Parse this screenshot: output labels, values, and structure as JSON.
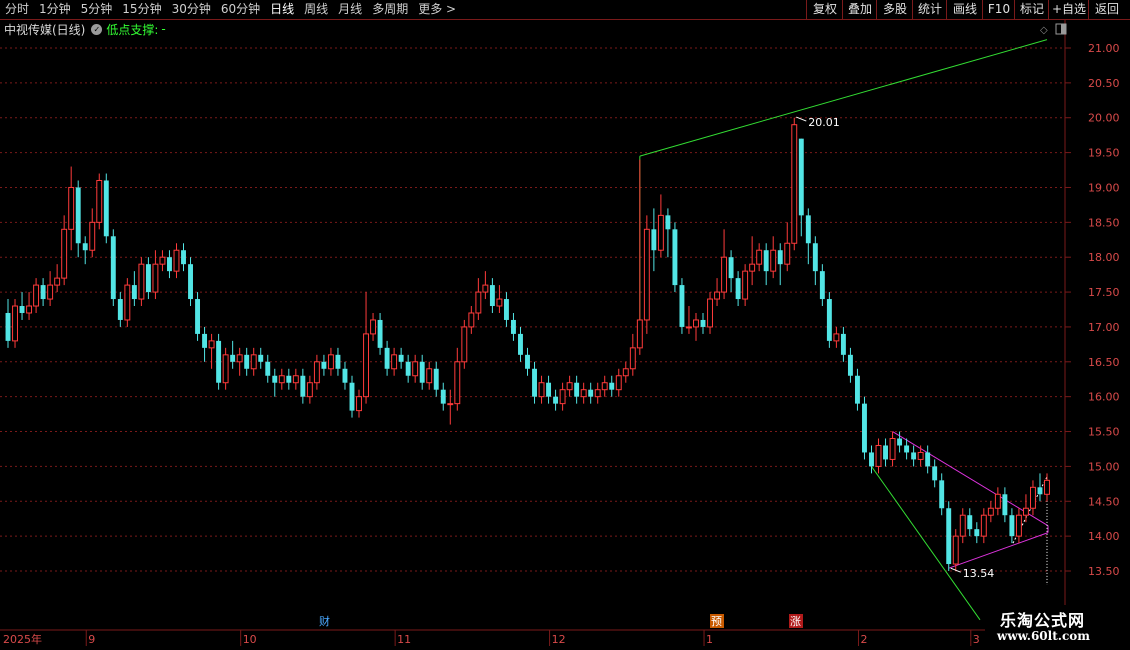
{
  "toolbar": {
    "periods": [
      "分时",
      "1分钟",
      "5分钟",
      "15分钟",
      "30分钟",
      "60分钟",
      "日线",
      "周线",
      "月线",
      "多周期",
      "更多"
    ],
    "active_period": "日线",
    "more_arrow": ">",
    "right_buttons": [
      "复权",
      "叠加",
      "多股",
      "统计",
      "画线",
      "F10",
      "标记",
      "+自选",
      "返回"
    ]
  },
  "titlebar": {
    "stock_title": "中视传媒(日线)",
    "indicator_name": "低点支撑:",
    "indicator_value": "-"
  },
  "markers": [
    "财",
    "预",
    "涨"
  ],
  "watermark": {
    "line1": "乐淘公式网",
    "line2": "www.60lt.com"
  },
  "colors": {
    "up": "#ff3b3b",
    "down": "#52e5e5",
    "grid": "#7a1a1a",
    "axis_text": "#d84a4a",
    "support_line": "#33dd33",
    "triangle_line": "#dd33dd"
  },
  "chart_data": {
    "type": "candlestick",
    "y_axis": {
      "ticks": [
        "13.50",
        "14.00",
        "14.50",
        "15.00",
        "15.50",
        "16.00",
        "16.50",
        "17.00",
        "17.50",
        "18.00",
        "18.50",
        "19.00",
        "19.50",
        "20.00",
        "20.50",
        "21.00"
      ],
      "range": [
        13.2,
        21.25
      ]
    },
    "x_axis": {
      "labels": [
        "2025年",
        "9",
        "10",
        "11",
        "12",
        "1",
        "2",
        "3"
      ]
    },
    "annotations": [
      {
        "label": "20.01",
        "price": 20.01
      },
      {
        "label": "13.54",
        "price": 13.54
      }
    ],
    "candles": [
      [
        17.2,
        16.8,
        17.4,
        16.7
      ],
      [
        16.8,
        17.3,
        17.4,
        16.7
      ],
      [
        17.3,
        17.2,
        17.5,
        17.1
      ],
      [
        17.2,
        17.3,
        17.5,
        17.1
      ],
      [
        17.3,
        17.6,
        17.7,
        17.2
      ],
      [
        17.6,
        17.4,
        17.7,
        17.3
      ],
      [
        17.4,
        17.6,
        17.8,
        17.3
      ],
      [
        17.6,
        17.7,
        17.9,
        17.5
      ],
      [
        17.7,
        18.4,
        18.6,
        17.6
      ],
      [
        18.4,
        19.0,
        19.3,
        18.1
      ],
      [
        19.0,
        18.2,
        19.1,
        18.0
      ],
      [
        18.2,
        18.1,
        18.3,
        17.9
      ],
      [
        18.1,
        18.5,
        18.7,
        18.0
      ],
      [
        18.5,
        19.1,
        19.2,
        18.4
      ],
      [
        19.1,
        18.3,
        19.2,
        18.2
      ],
      [
        18.3,
        17.4,
        18.4,
        17.3
      ],
      [
        17.4,
        17.1,
        17.5,
        17.0
      ],
      [
        17.1,
        17.6,
        17.7,
        17.0
      ],
      [
        17.6,
        17.4,
        17.8,
        17.3
      ],
      [
        17.4,
        17.9,
        18.0,
        17.3
      ],
      [
        17.9,
        17.5,
        18.0,
        17.4
      ],
      [
        17.5,
        17.9,
        18.1,
        17.4
      ],
      [
        17.9,
        18.0,
        18.1,
        17.8
      ],
      [
        18.0,
        17.8,
        18.1,
        17.7
      ],
      [
        17.8,
        18.1,
        18.2,
        17.7
      ],
      [
        18.1,
        17.9,
        18.2,
        17.8
      ],
      [
        17.9,
        17.4,
        18.0,
        17.3
      ],
      [
        17.4,
        16.9,
        17.5,
        16.8
      ],
      [
        16.9,
        16.7,
        17.0,
        16.5
      ],
      [
        16.7,
        16.8,
        16.9,
        16.4
      ],
      [
        16.8,
        16.2,
        16.9,
        16.1
      ],
      [
        16.2,
        16.6,
        16.7,
        16.1
      ],
      [
        16.6,
        16.5,
        16.8,
        16.4
      ],
      [
        16.5,
        16.6,
        16.7,
        16.3
      ],
      [
        16.6,
        16.4,
        16.7,
        16.3
      ],
      [
        16.4,
        16.6,
        16.7,
        16.3
      ],
      [
        16.6,
        16.5,
        16.7,
        16.4
      ],
      [
        16.5,
        16.3,
        16.6,
        16.2
      ],
      [
        16.3,
        16.2,
        16.4,
        16.0
      ],
      [
        16.2,
        16.3,
        16.4,
        16.1
      ],
      [
        16.3,
        16.2,
        16.4,
        16.1
      ],
      [
        16.2,
        16.3,
        16.4,
        16.1
      ],
      [
        16.3,
        16.0,
        16.4,
        15.9
      ],
      [
        16.0,
        16.2,
        16.3,
        15.9
      ],
      [
        16.2,
        16.5,
        16.6,
        16.1
      ],
      [
        16.5,
        16.4,
        16.6,
        16.3
      ],
      [
        16.4,
        16.6,
        16.7,
        16.3
      ],
      [
        16.6,
        16.4,
        16.7,
        16.3
      ],
      [
        16.4,
        16.2,
        16.5,
        16.1
      ],
      [
        16.2,
        15.8,
        16.3,
        15.7
      ],
      [
        15.8,
        16.0,
        16.1,
        15.7
      ],
      [
        16.0,
        16.9,
        17.5,
        15.9
      ],
      [
        16.9,
        17.1,
        17.2,
        16.8
      ],
      [
        17.1,
        16.7,
        17.2,
        16.6
      ],
      [
        16.7,
        16.4,
        16.8,
        16.3
      ],
      [
        16.4,
        16.6,
        16.7,
        16.3
      ],
      [
        16.6,
        16.5,
        16.7,
        16.4
      ],
      [
        16.5,
        16.3,
        16.6,
        16.2
      ],
      [
        16.3,
        16.5,
        16.6,
        16.2
      ],
      [
        16.5,
        16.2,
        16.6,
        16.1
      ],
      [
        16.2,
        16.4,
        16.5,
        16.1
      ],
      [
        16.4,
        16.1,
        16.5,
        16.0
      ],
      [
        16.1,
        15.9,
        16.2,
        15.8
      ],
      [
        15.9,
        15.9,
        16.1,
        15.6
      ],
      [
        15.9,
        16.5,
        16.7,
        15.8
      ],
      [
        16.5,
        17.0,
        17.1,
        16.4
      ],
      [
        17.0,
        17.2,
        17.3,
        16.9
      ],
      [
        17.2,
        17.5,
        17.7,
        17.1
      ],
      [
        17.5,
        17.6,
        17.8,
        17.4
      ],
      [
        17.6,
        17.3,
        17.7,
        17.2
      ],
      [
        17.3,
        17.4,
        17.6,
        17.2
      ],
      [
        17.4,
        17.1,
        17.5,
        17.0
      ],
      [
        17.1,
        16.9,
        17.2,
        16.8
      ],
      [
        16.9,
        16.6,
        17.0,
        16.5
      ],
      [
        16.6,
        16.4,
        16.7,
        16.3
      ],
      [
        16.4,
        16.0,
        16.5,
        15.9
      ],
      [
        16.0,
        16.2,
        16.3,
        15.9
      ],
      [
        16.2,
        16.0,
        16.3,
        15.9
      ],
      [
        16.0,
        15.9,
        16.1,
        15.8
      ],
      [
        15.9,
        16.1,
        16.2,
        15.8
      ],
      [
        16.1,
        16.2,
        16.3,
        16.0
      ],
      [
        16.2,
        16.0,
        16.3,
        15.9
      ],
      [
        16.0,
        16.1,
        16.2,
        15.9
      ],
      [
        16.1,
        16.0,
        16.2,
        15.9
      ],
      [
        16.0,
        16.1,
        16.2,
        15.9
      ],
      [
        16.1,
        16.2,
        16.3,
        16.0
      ],
      [
        16.2,
        16.1,
        16.3,
        16.0
      ],
      [
        16.1,
        16.3,
        16.4,
        16.0
      ],
      [
        16.3,
        16.4,
        16.5,
        16.2
      ],
      [
        16.4,
        16.7,
        16.9,
        16.3
      ],
      [
        16.7,
        17.1,
        19.4,
        16.6
      ],
      [
        17.1,
        18.4,
        18.6,
        16.9
      ],
      [
        18.4,
        18.1,
        18.7,
        17.8
      ],
      [
        18.1,
        18.6,
        18.9,
        18.0
      ],
      [
        18.6,
        18.4,
        18.7,
        18.0
      ],
      [
        18.4,
        17.6,
        18.5,
        17.5
      ],
      [
        17.6,
        17.0,
        17.7,
        16.9
      ],
      [
        17.0,
        17.0,
        17.3,
        16.9
      ],
      [
        17.0,
        17.1,
        17.2,
        16.8
      ],
      [
        17.1,
        17.0,
        17.2,
        16.9
      ],
      [
        17.0,
        17.4,
        17.5,
        16.9
      ],
      [
        17.4,
        17.5,
        17.7,
        17.3
      ],
      [
        17.5,
        18.0,
        18.4,
        17.4
      ],
      [
        18.0,
        17.7,
        18.1,
        17.5
      ],
      [
        17.7,
        17.4,
        17.8,
        17.3
      ],
      [
        17.4,
        17.8,
        17.9,
        17.3
      ],
      [
        17.8,
        17.9,
        18.3,
        17.6
      ],
      [
        17.9,
        18.1,
        18.2,
        17.8
      ],
      [
        18.1,
        17.8,
        18.2,
        17.6
      ],
      [
        17.8,
        18.1,
        18.3,
        17.7
      ],
      [
        18.1,
        17.9,
        18.2,
        17.6
      ],
      [
        17.9,
        18.2,
        18.5,
        17.8
      ],
      [
        18.2,
        19.9,
        20.0,
        18.1
      ],
      [
        19.7,
        18.6,
        19.7,
        18.3
      ],
      [
        18.6,
        18.2,
        18.7,
        17.9
      ],
      [
        18.2,
        17.8,
        18.3,
        17.6
      ],
      [
        17.8,
        17.4,
        17.9,
        17.3
      ],
      [
        17.4,
        16.8,
        17.5,
        16.7
      ],
      [
        16.8,
        16.9,
        17.0,
        16.7
      ],
      [
        16.9,
        16.6,
        17.0,
        16.5
      ],
      [
        16.6,
        16.3,
        16.7,
        16.2
      ],
      [
        16.3,
        15.9,
        16.4,
        15.8
      ],
      [
        15.9,
        15.2,
        16.0,
        15.1
      ],
      [
        15.2,
        15.0,
        15.3,
        14.9
      ],
      [
        15.0,
        15.3,
        15.4,
        14.9
      ],
      [
        15.3,
        15.1,
        15.4,
        15.0
      ],
      [
        15.1,
        15.4,
        15.5,
        15.0
      ],
      [
        15.4,
        15.3,
        15.5,
        15.2
      ],
      [
        15.3,
        15.2,
        15.4,
        15.1
      ],
      [
        15.2,
        15.1,
        15.3,
        15.0
      ],
      [
        15.1,
        15.2,
        15.3,
        15.0
      ],
      [
        15.2,
        15.0,
        15.3,
        14.9
      ],
      [
        15.0,
        14.8,
        15.1,
        14.7
      ],
      [
        14.8,
        14.4,
        14.9,
        14.3
      ],
      [
        14.4,
        13.6,
        14.5,
        13.5
      ],
      [
        13.6,
        14.0,
        14.1,
        13.5
      ],
      [
        14.0,
        14.3,
        14.4,
        13.9
      ],
      [
        14.3,
        14.1,
        14.4,
        14.0
      ],
      [
        14.1,
        14.0,
        14.2,
        13.9
      ],
      [
        14.0,
        14.3,
        14.4,
        13.9
      ],
      [
        14.3,
        14.4,
        14.5,
        14.2
      ],
      [
        14.4,
        14.6,
        14.7,
        14.3
      ],
      [
        14.6,
        14.3,
        14.7,
        14.2
      ],
      [
        14.3,
        14.0,
        14.4,
        13.9
      ],
      [
        14.0,
        14.3,
        14.4,
        13.9
      ],
      [
        14.3,
        14.4,
        14.6,
        14.2
      ],
      [
        14.4,
        14.7,
        14.8,
        14.3
      ],
      [
        14.7,
        14.6,
        14.9,
        14.5
      ],
      [
        14.6,
        14.8,
        14.9,
        14.5
      ]
    ]
  }
}
